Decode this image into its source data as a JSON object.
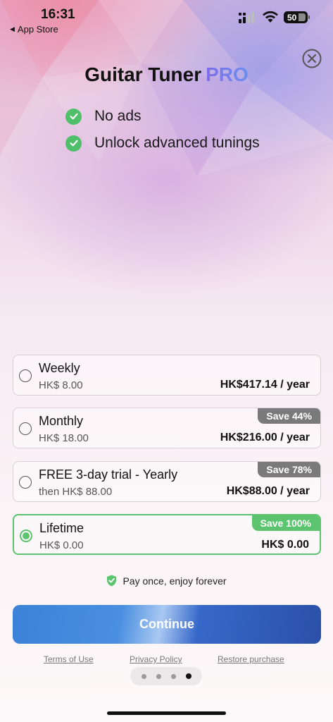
{
  "status_bar": {
    "time": "16:31",
    "back_label": "App Store",
    "battery": "50",
    "icons": [
      "signal-icon",
      "wifi-icon",
      "battery-icon"
    ]
  },
  "header": {
    "title": "Guitar Tuner",
    "title_badge": "PRO",
    "close_icon": "close-circle-icon"
  },
  "features": [
    {
      "label": "No ads",
      "icon": "check-circle-icon"
    },
    {
      "label": "Unlock advanced tunings",
      "icon": "check-circle-icon"
    }
  ],
  "plans": [
    {
      "name": "Weekly",
      "sub": "HK$ 8.00",
      "price": "HK$417.14 / year",
      "badge": "",
      "selected": false
    },
    {
      "name": "Monthly",
      "sub": "HK$ 18.00",
      "price": "HK$216.00 / year",
      "badge": "Save 44%",
      "selected": false
    },
    {
      "name": "FREE 3-day trial - Yearly",
      "sub": "then HK$ 88.00",
      "price": "HK$88.00 / year",
      "badge": "Save 78%",
      "selected": false
    },
    {
      "name": "Lifetime",
      "sub": "HK$ 0.00",
      "price": "HK$ 0.00",
      "badge": "Save 100%",
      "selected": true
    }
  ],
  "pay_once": {
    "label": "Pay once, enjoy forever",
    "icon": "shield-check-icon"
  },
  "continue_label": "Continue",
  "footer": {
    "terms": "Terms of Use",
    "privacy": "Privacy Policy",
    "restore": "Restore purchase"
  },
  "pager": {
    "count": 4,
    "active_index": 3
  },
  "colors": {
    "accent_green": "#5cc46f",
    "badge_gray": "#7a7a7a",
    "button_blue": "#3b82d8",
    "pro_purple": "#7f6de8"
  }
}
